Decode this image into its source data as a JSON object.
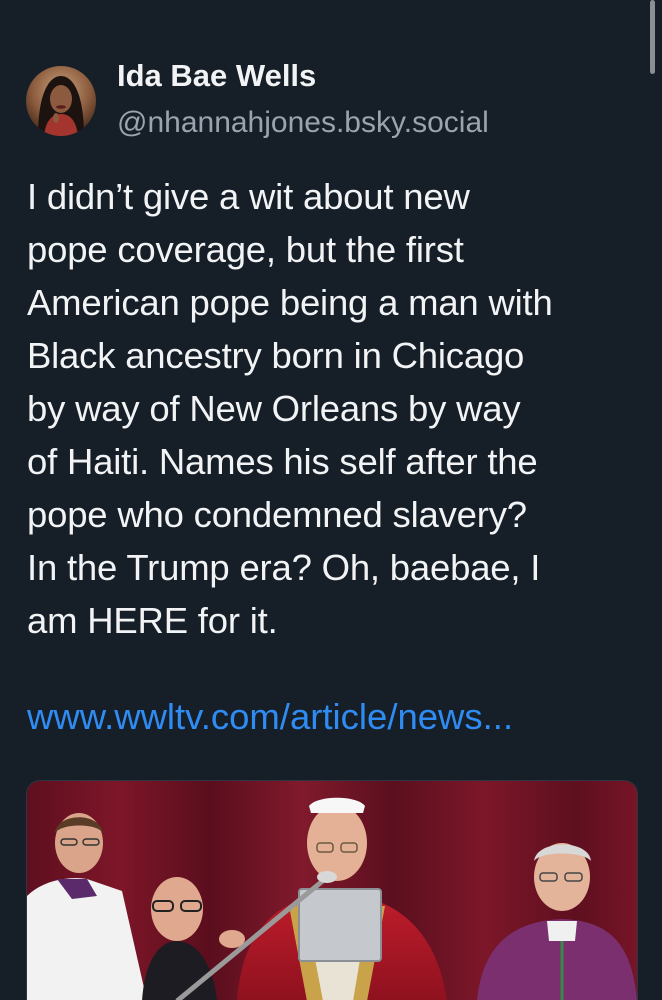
{
  "author": {
    "display_name": "Ida Bae Wells",
    "handle": "@nhannahjones.bsky.social",
    "avatar_icon": "profile-photo"
  },
  "post": {
    "lines": [
      "I didn’t give a wit about new",
      "pope coverage, but the first",
      "American pope being a man with",
      "Black ancestry born in Chicago",
      "by way of New Orleans by way",
      "of Haiti. Names his self after the",
      "pope who condemned slavery?",
      "In the Trump era? Oh, baebae, I",
      "am HERE for it."
    ],
    "link_text": "www.wwltv.com/article/news..."
  },
  "embed": {
    "image_icon": "link-card-photo"
  },
  "colors": {
    "background": "#161e27",
    "text": "#f1f3f5",
    "secondary_text": "#9aa4af",
    "link": "#2f8cf2"
  }
}
